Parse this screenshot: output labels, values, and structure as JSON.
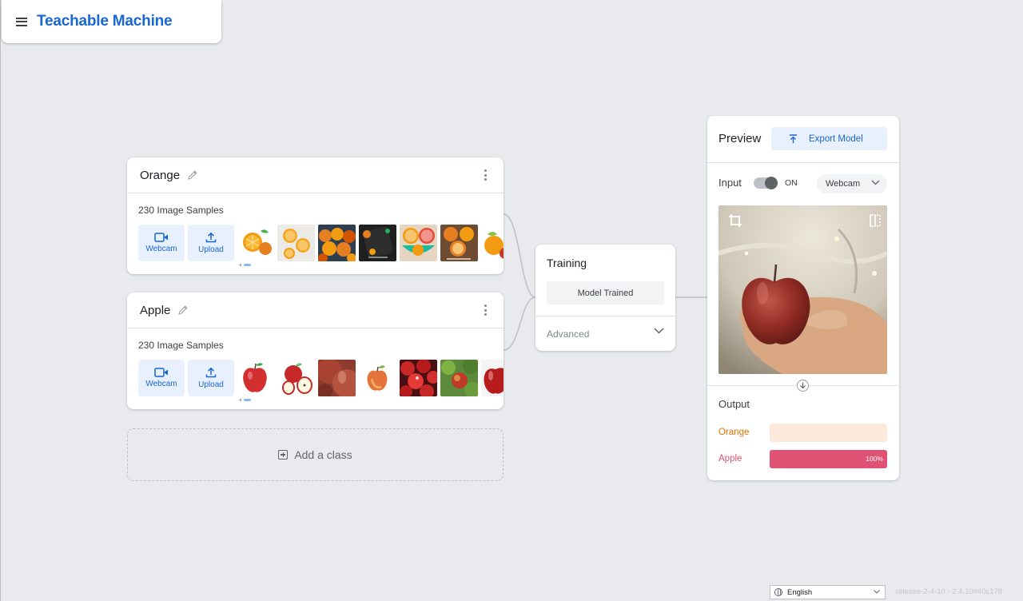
{
  "header": {
    "logo": "Teachable Machine",
    "menu_icon": "hamburger-menu-icon"
  },
  "classes": [
    {
      "name": "Orange",
      "samples_label": "230 Image Samples",
      "webcam_label": "Webcam",
      "upload_label": "Upload",
      "thumbnail_subjects": [
        "orange-slices",
        "orange-halves-on-white",
        "pile-of-oranges",
        "oranges-on-dark-board",
        "sliced-oranges-in-bowl",
        "oranges-on-wood",
        "whole-orange-with-leaf"
      ]
    },
    {
      "name": "Apple",
      "samples_label": "230 Image Samples",
      "webcam_label": "Webcam",
      "upload_label": "Upload",
      "thumbnail_subjects": [
        "red-apple",
        "apple-with-halves",
        "red-apple-closeup",
        "single-apple",
        "red-apples-pile",
        "apples-on-tree",
        "red-apple-partial"
      ]
    }
  ],
  "add_class": {
    "label": "Add a class"
  },
  "training": {
    "title": "Training",
    "button_label": "Model Trained",
    "advanced_label": "Advanced"
  },
  "preview": {
    "title": "Preview",
    "export_label": "Export Model",
    "input_label": "Input",
    "toggle_state": "ON",
    "toggle_on": true,
    "source_select": "Webcam",
    "output_label": "Output",
    "outputs": [
      {
        "class": "Orange",
        "percent": 0,
        "percent_label": "",
        "color": "#e37400",
        "track": "#fde8dc"
      },
      {
        "class": "Apple",
        "percent": 100,
        "percent_label": "100%",
        "color": "#e05273",
        "track": "#fbe0e7"
      }
    ]
  },
  "footer": {
    "language": "English",
    "release": "release-2-4-10 - 2.4.10#40c178"
  },
  "colors": {
    "accent": "#1967d2",
    "accent_bg": "#e8f0fe",
    "canvas": "#e8eaed"
  }
}
